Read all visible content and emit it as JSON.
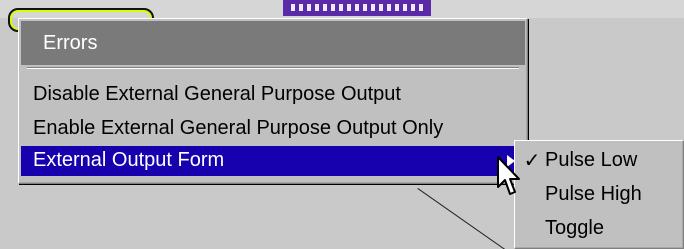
{
  "menu": {
    "items": [
      {
        "label": "Errors"
      },
      {
        "label": "Disable External General Purpose Output"
      },
      {
        "label": "Enable External General Purpose Output Only"
      },
      {
        "label": "External Output Form"
      }
    ]
  },
  "submenu": {
    "items": [
      {
        "label": "Pulse Low",
        "checked": true
      },
      {
        "label": "Pulse High",
        "checked": false
      },
      {
        "label": "Toggle",
        "checked": false
      }
    ]
  },
  "icons": {
    "submenu_arrow": "arrow-right-icon",
    "check": "checkmark-icon",
    "cursor": "mouse-pointer-icon"
  },
  "colors": {
    "menu_bg": "#c0c0c0",
    "disabled_header_bg": "#7a7a7a",
    "selection_bg": "#1700ad",
    "text": "#000000",
    "selected_text": "#ffffff"
  }
}
